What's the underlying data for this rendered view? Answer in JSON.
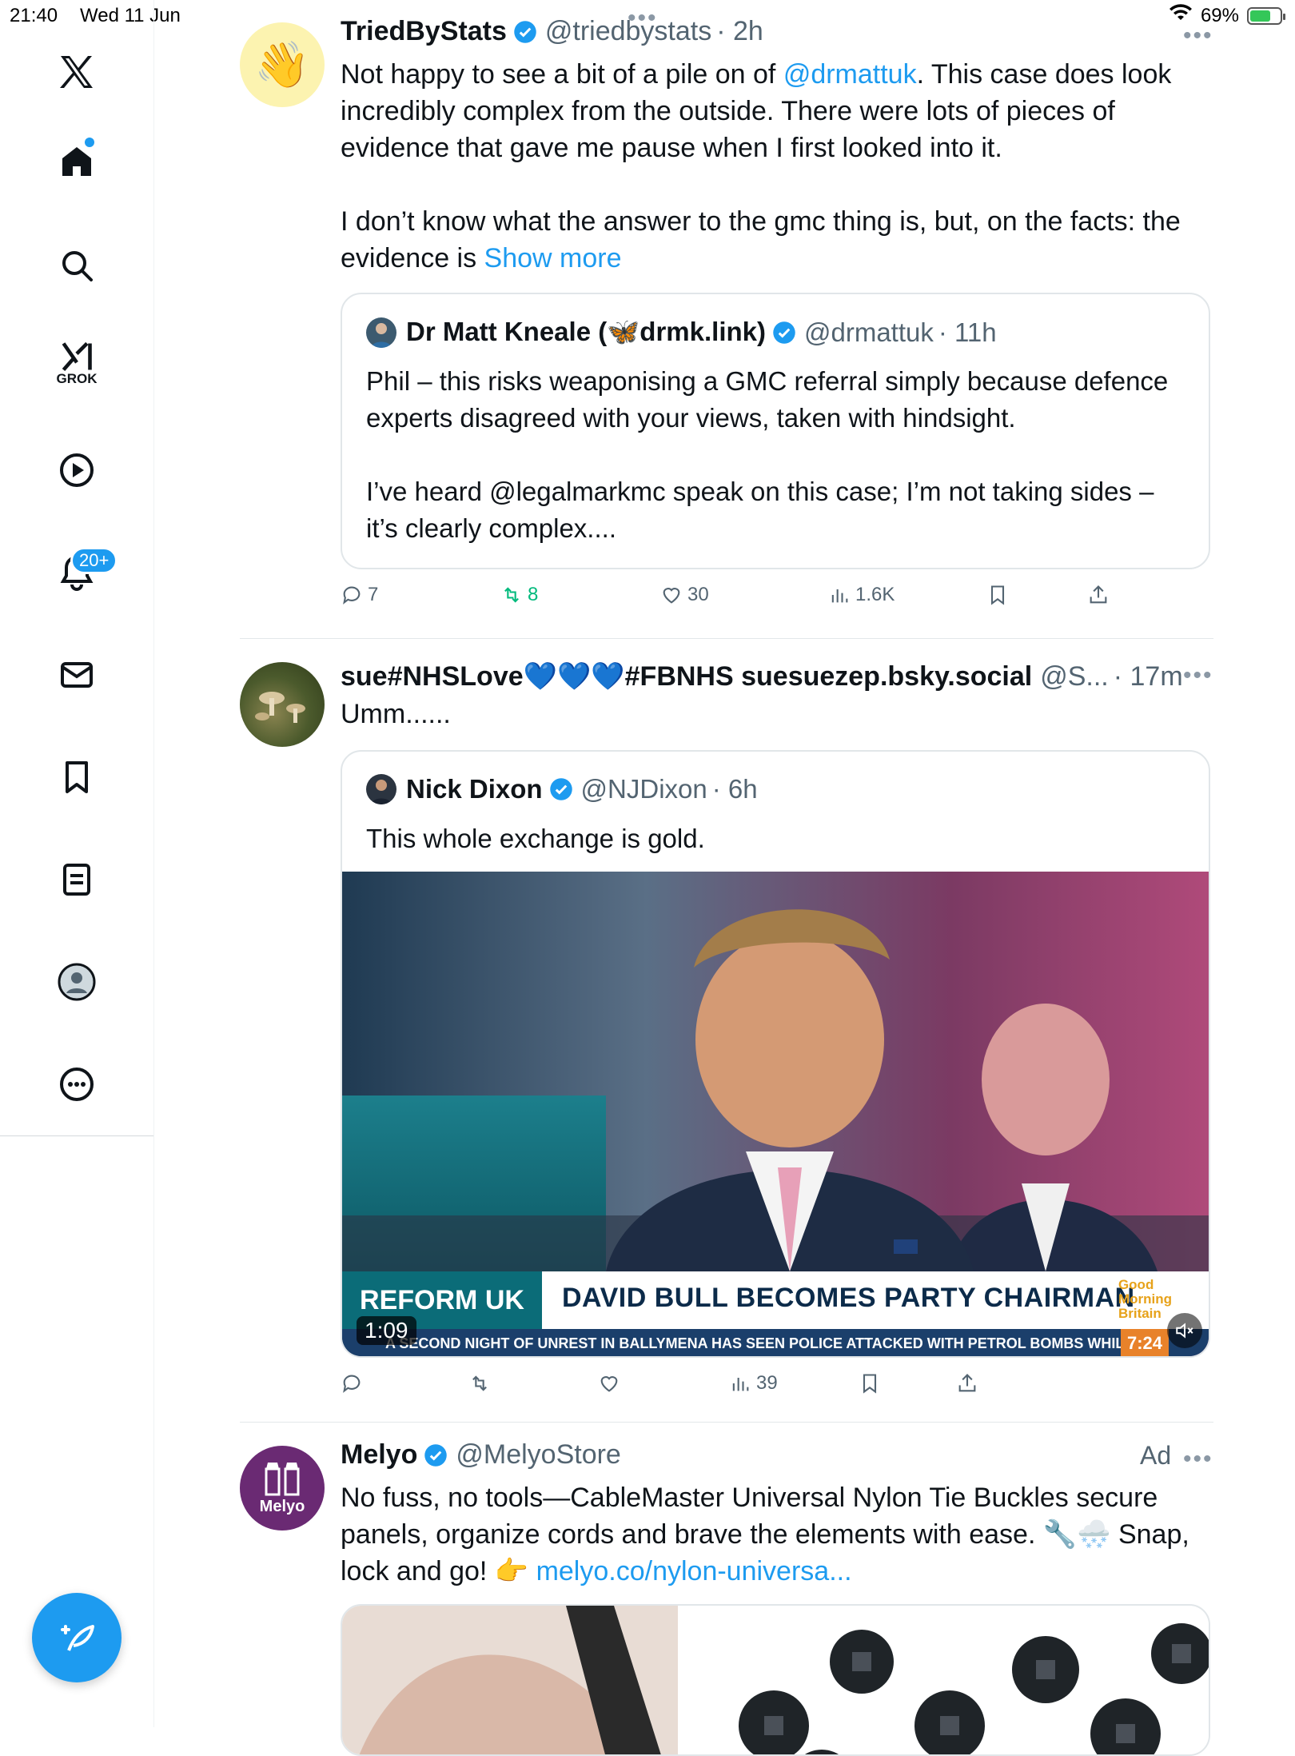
{
  "status_bar": {
    "time": "21:40",
    "date": "Wed 11 Jun",
    "battery": "69%",
    "battery_level": 0.69
  },
  "sidebar": {
    "notifications_badge": "20+",
    "grok_label": "GROK"
  },
  "colors": {
    "accent": "#1d9bf0",
    "repost_green": "#00ba7c",
    "muted": "#536471"
  },
  "tweets": [
    {
      "name": "TriedByStats",
      "handle": "@triedbystats",
      "time": "· 2h",
      "text_before_link": "Not happy to see a bit of a pile on of ",
      "mention": "@drmattuk",
      "text_after_link": ". This case does look incredibly complex from the outside. There were lots of pieces of evidence that gave me pause when I first looked into it.",
      "text_p2": "I don’t know what the answer to the gmc thing is, but, on the facts: the evidence is ",
      "show_more": "Show more",
      "avatar_icon": "waving-hand-emoji",
      "quote": {
        "name": "Dr Matt Kneale (🦋drmk.link)",
        "handle": "@drmattuk",
        "time": "· 11h",
        "p1": "Phil – this risks weaponising a GMC referral simply because defence experts disagreed with your views, taken with hindsight.",
        "p2": "I’ve heard @legalmarkmc speak on this case; I’m not taking sides – it’s clearly complex...."
      },
      "stats": {
        "replies": "7",
        "reposts": "8",
        "likes": "30",
        "views": "1.6K"
      }
    },
    {
      "name": "sue#NHSLove💙💙💙#FBNHS suesuezep.bsky.social",
      "handle": "@S...",
      "time": "· 17m",
      "text": "Umm......",
      "quote": {
        "name": "Nick Dixon",
        "handle": "@NJDixon",
        "time": "· 6h",
        "text": "This whole exchange is gold.",
        "video": {
          "party": "REFORM UK",
          "headline": "DAVID BULL BECOMES PARTY CHAIRMAN",
          "show_logo": "Good Morning Britain",
          "ticker": "A SECOND NIGHT OF UNREST IN BALLYMENA HAS SEEN POLICE ATTACKED WITH PETROL BOMBS WHILE",
          "clock": "7:24",
          "duration": "1:09"
        }
      },
      "stats": {
        "views": "39"
      }
    },
    {
      "name": "Melyo",
      "handle": "@MelyoStore",
      "ad_label": "Ad",
      "avatar_text": "Melyo",
      "text": "No fuss, no tools—CableMaster Universal Nylon Tie Buckles secure panels, organize cords and brave the elements with ease. 🔧🌨️ Snap, lock and go! 👉 ",
      "link": "melyo.co/nylon-universa..."
    }
  ]
}
